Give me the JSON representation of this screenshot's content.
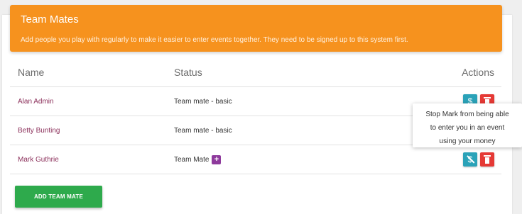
{
  "panel": {
    "title": "Team Mates",
    "subtitle": "Add people you play with regularly to make it easier to enter events together. They need to be signed up to this system first."
  },
  "table": {
    "headers": {
      "name": "Name",
      "status": "Status",
      "actions": "Actions"
    },
    "rows": [
      {
        "name": "Alan Admin",
        "status": "Team mate - basic",
        "money_icon": "$"
      },
      {
        "name": "Betty Bunting",
        "status": "Team mate - basic",
        "money_icon": "$"
      },
      {
        "name": "Mark Guthrie",
        "status": "Team Mate",
        "badge": "+",
        "money_icon": "$"
      }
    ]
  },
  "tooltip": {
    "line1": "Stop Mark from being able",
    "line2": "to enter you in an event",
    "line3": "using your money"
  },
  "buttons": {
    "add_team_mate": "ADD TEAM MATE"
  },
  "colors": {
    "header_bg": "#f6921e",
    "money_button": "#2aa2b8",
    "delete_button": "#e53935",
    "add_button": "#2eaa4c",
    "badge": "#8e3a9c",
    "name_link": "#8b2f5a"
  }
}
